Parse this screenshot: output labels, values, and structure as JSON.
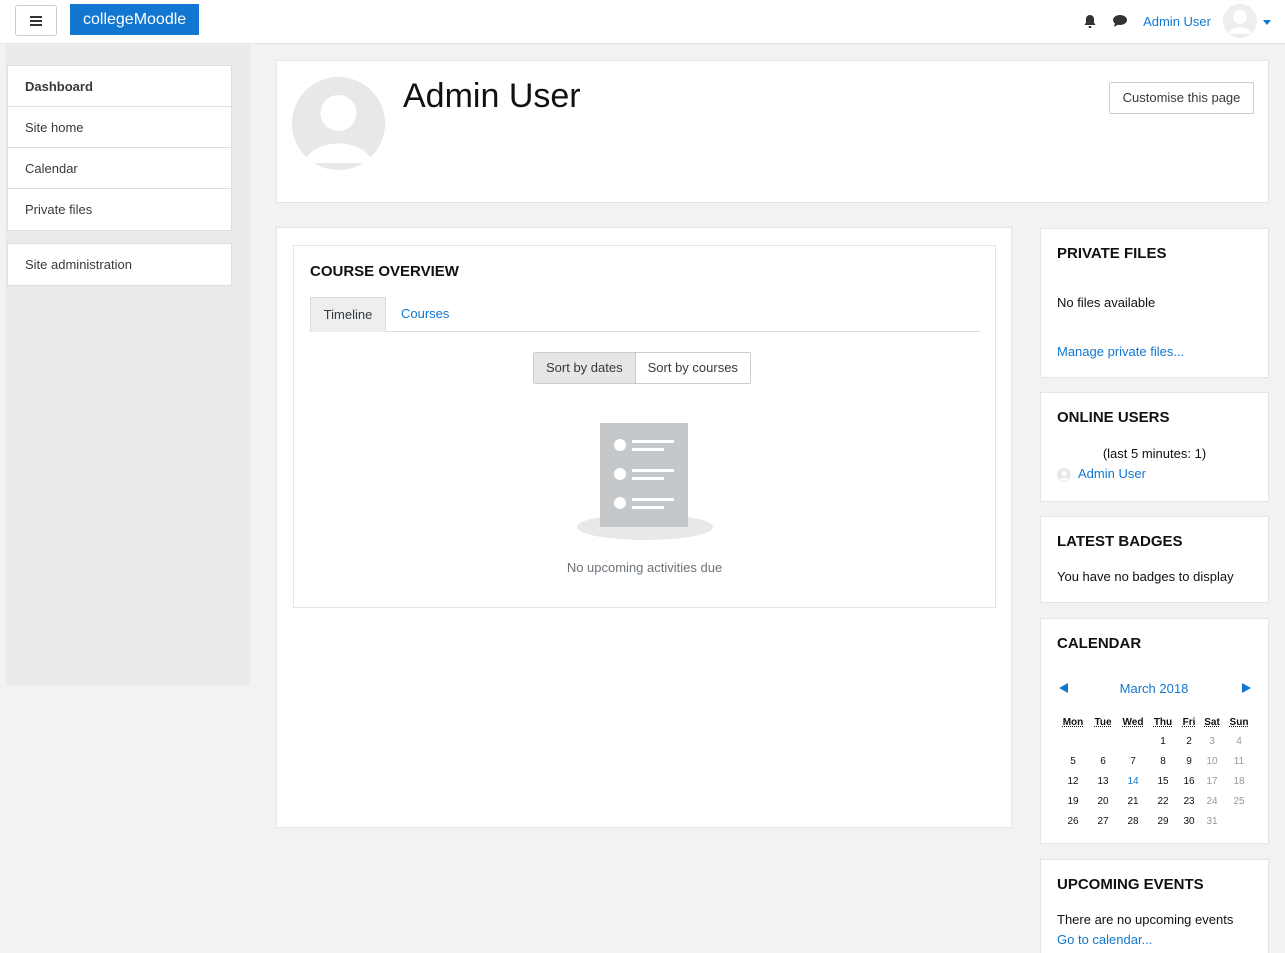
{
  "navbar": {
    "brand": "collegeMoodle",
    "user_name": "Admin User",
    "icons": [
      "menu-icon",
      "bell-icon",
      "chat-bubble-icon",
      "user-avatar-icon",
      "caret-down-icon"
    ]
  },
  "drawer": {
    "items": [
      {
        "label": "Dashboard",
        "active": true
      },
      {
        "label": "Site home"
      },
      {
        "label": "Calendar"
      },
      {
        "label": "Private files"
      }
    ],
    "admin_item": "Site administration"
  },
  "header": {
    "title": "Admin User",
    "customise_label": "Customise this page"
  },
  "course_overview": {
    "title": "COURSE OVERVIEW",
    "tabs": [
      "Timeline",
      "Courses"
    ],
    "sort_buttons": [
      "Sort by dates",
      "Sort by courses"
    ],
    "empty_text": "No upcoming activities due"
  },
  "private_files": {
    "title": "PRIVATE FILES",
    "empty_text": "No files available",
    "manage_link": "Manage private files..."
  },
  "online_users": {
    "title": "ONLINE USERS",
    "summary": "(last 5 minutes: 1)",
    "user": "Admin User"
  },
  "latest_badges": {
    "title": "LATEST BADGES",
    "text": "You have no badges to display"
  },
  "calendar": {
    "title": "CALENDAR",
    "month": "March 2018",
    "weekdays": [
      "Mon",
      "Tue",
      "Wed",
      "Thu",
      "Fri",
      "Sat",
      "Sun"
    ],
    "weeks": [
      [
        "",
        "",
        "",
        "1",
        "2",
        "3",
        "4"
      ],
      [
        "5",
        "6",
        "7",
        "8",
        "9",
        "10",
        "11"
      ],
      [
        "12",
        "13",
        "14",
        "15",
        "16",
        "17",
        "18"
      ],
      [
        "19",
        "20",
        "21",
        "22",
        "23",
        "24",
        "25"
      ],
      [
        "26",
        "27",
        "28",
        "29",
        "30",
        "31",
        ""
      ]
    ],
    "today": "14"
  },
  "upcoming_events": {
    "title": "UPCOMING EVENTS",
    "text": "There are no upcoming events",
    "link": "Go to calendar..."
  },
  "colors": {
    "accent": "#1177d1",
    "page_background": "#f2f2f2",
    "drawer_background": "#e9eaec"
  }
}
